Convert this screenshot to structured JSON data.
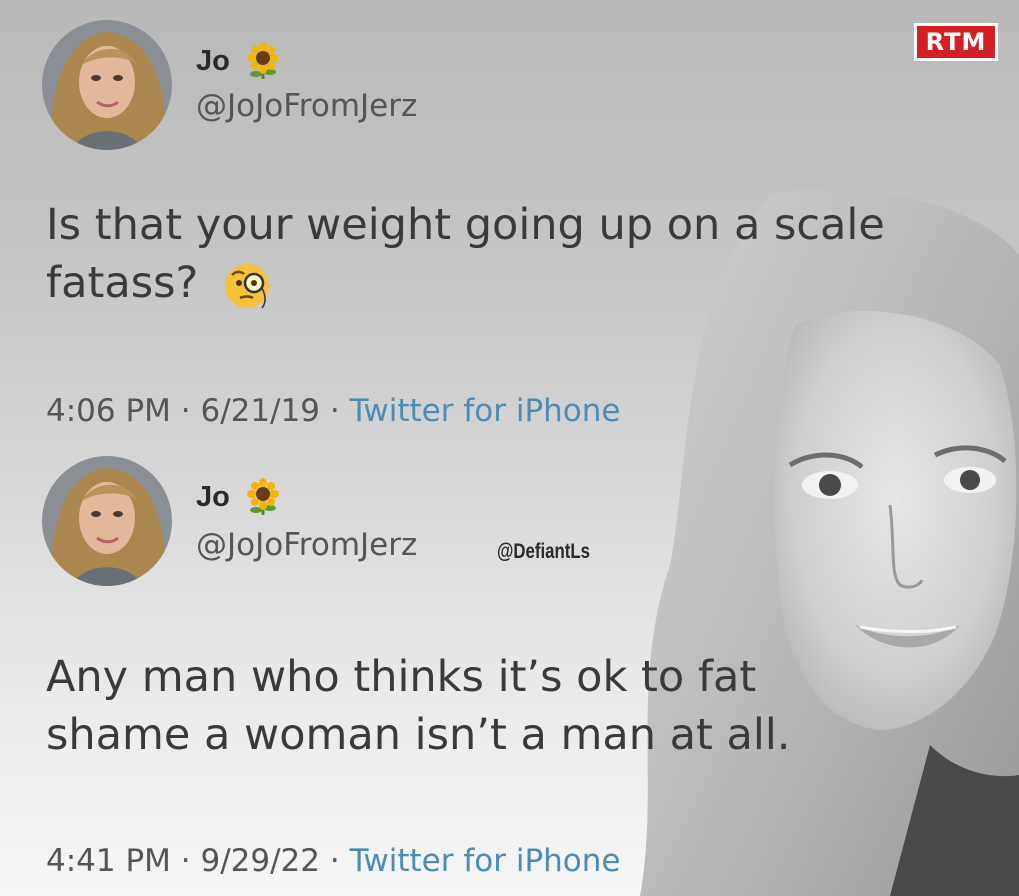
{
  "brand_badge": "RTM",
  "watermark": "@DefiantLs",
  "colors": {
    "source_link": "#4b8cb6",
    "badge_red": "#d41f26"
  },
  "tweets": [
    {
      "display_name": "Jo",
      "name_emoji": "sunflower-icon",
      "handle": "@JoJoFromJerz",
      "text": "Is that your weight going up on a scale fatass?",
      "text_emoji": "face-with-monocle-icon",
      "time": "4:06 PM",
      "date": "6/21/19",
      "source": "Twitter for iPhone"
    },
    {
      "display_name": "Jo",
      "name_emoji": "sunflower-icon",
      "handle": "@JoJoFromJerz",
      "text": "Any man who thinks it’s ok to fat shame a woman isn’t a man at all.",
      "time": "4:41 PM",
      "date": "9/29/22",
      "source": "Twitter for iPhone"
    }
  ]
}
